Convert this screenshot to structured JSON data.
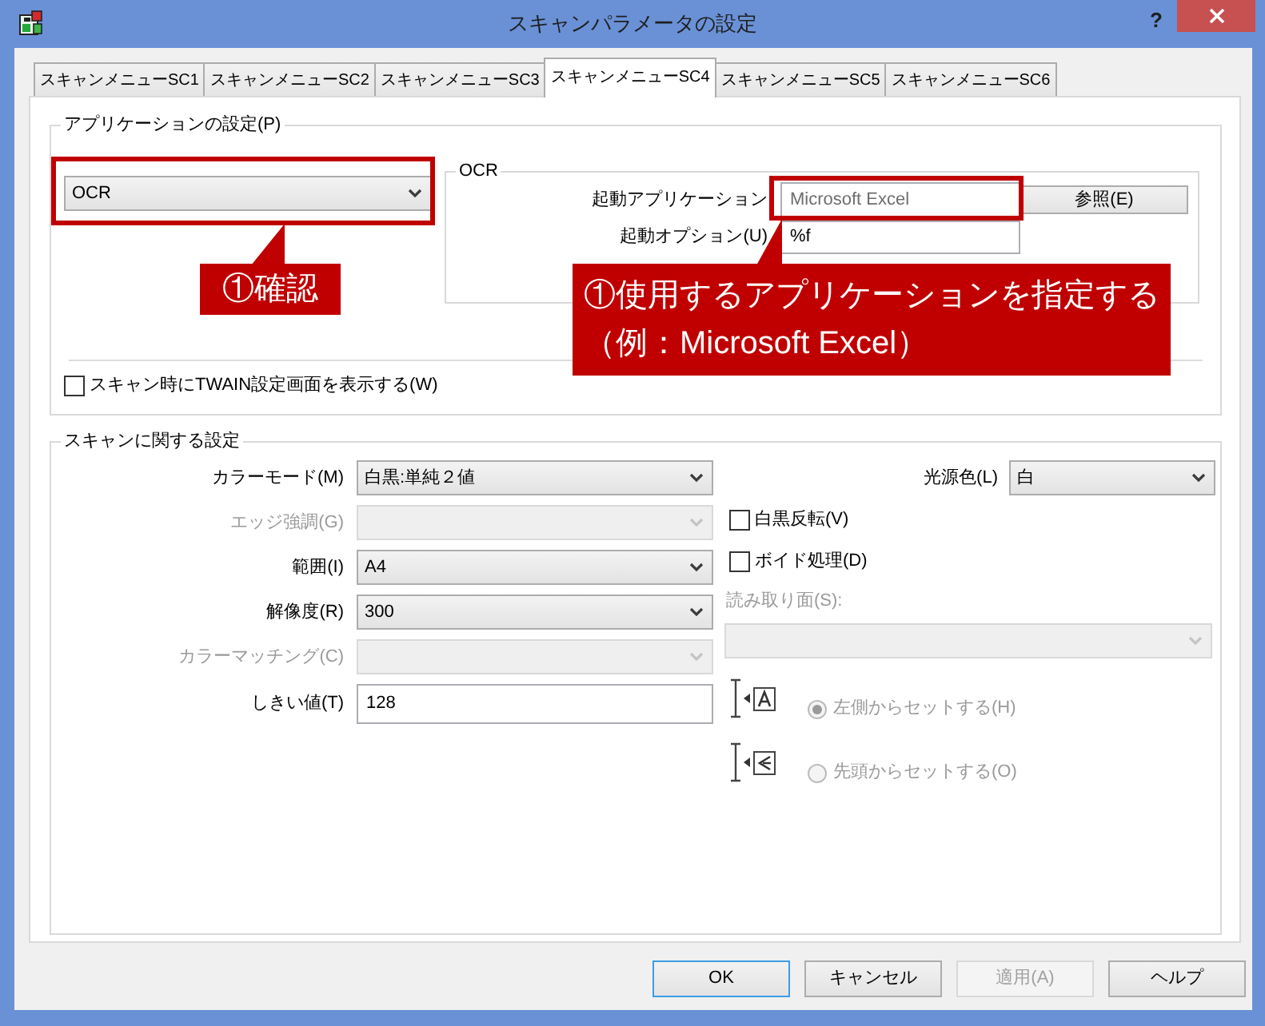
{
  "window": {
    "title": "スキャンパラメータの設定",
    "help_button": "?"
  },
  "tabs": [
    {
      "label": "スキャンメニューSC1",
      "selected": false
    },
    {
      "label": "スキャンメニューSC2",
      "selected": false
    },
    {
      "label": "スキャンメニューSC3",
      "selected": false
    },
    {
      "label": "スキャンメニューSC4",
      "selected": true
    },
    {
      "label": "スキャンメニューSC5",
      "selected": false
    },
    {
      "label": "スキャンメニューSC6",
      "selected": false
    }
  ],
  "application_settings": {
    "legend": "アプリケーションの設定(P)",
    "application_dropdown": {
      "value": "OCR"
    },
    "ocr_group": {
      "legend": "OCR",
      "fields": [
        {
          "label": "起動アプリケーション",
          "value": "Microsoft Excel",
          "readonly": true
        },
        {
          "label": "起動オプション(U)",
          "value": "%f",
          "readonly": false
        }
      ],
      "browse_button": "参照(E)"
    },
    "show_twain_checkbox": {
      "label": "スキャン時にTWAIN設定画面を表示する(W)",
      "checked": false
    }
  },
  "scan_settings": {
    "legend": "スキャンに関する設定",
    "rows": [
      {
        "kind": "dropdown",
        "label": "カラーモード(M)",
        "value": "白黒:単純２値",
        "disabled": false
      },
      {
        "kind": "dropdown",
        "label": "エッジ強調(G)",
        "disabled": true
      },
      {
        "kind": "dropdown",
        "label": "範囲(I)",
        "value": "A4",
        "disabled": false
      },
      {
        "kind": "dropdown",
        "label": "解像度(R)",
        "value": "300",
        "disabled": false
      },
      {
        "kind": "dropdown",
        "label": "カラーマッチング(C)",
        "disabled": true
      },
      {
        "kind": "text_field",
        "label": "しきい値(T)",
        "value": "128",
        "disabled": false
      }
    ],
    "light_source": {
      "label": "光源色(L)",
      "value": "白"
    },
    "checkboxes": [
      {
        "label": "白黒反転(V)",
        "checked": false
      },
      {
        "label": "ボイド処理(D)",
        "checked": false
      }
    ],
    "read_side": {
      "label": "読み取り面(S):",
      "disabled": true
    },
    "feed_options": [
      {
        "label": "左側からセットする(H)",
        "selected": true,
        "disabled": true
      },
      {
        "label": "先頭からセットする(O)",
        "selected": false,
        "disabled": true
      }
    ]
  },
  "buttons": [
    {
      "label": "OK",
      "default": true,
      "disabled": false
    },
    {
      "label": "キャンセル",
      "default": false,
      "disabled": false
    },
    {
      "label": "適用(A)",
      "default": false,
      "disabled": true
    },
    {
      "label": "ヘルプ",
      "default": false,
      "disabled": false
    }
  ],
  "callouts": [
    {
      "lines": [
        "①確認"
      ]
    },
    {
      "lines": [
        "①使用するアプリケーションを指定する",
        "（例：Microsoft Excel）"
      ]
    }
  ]
}
